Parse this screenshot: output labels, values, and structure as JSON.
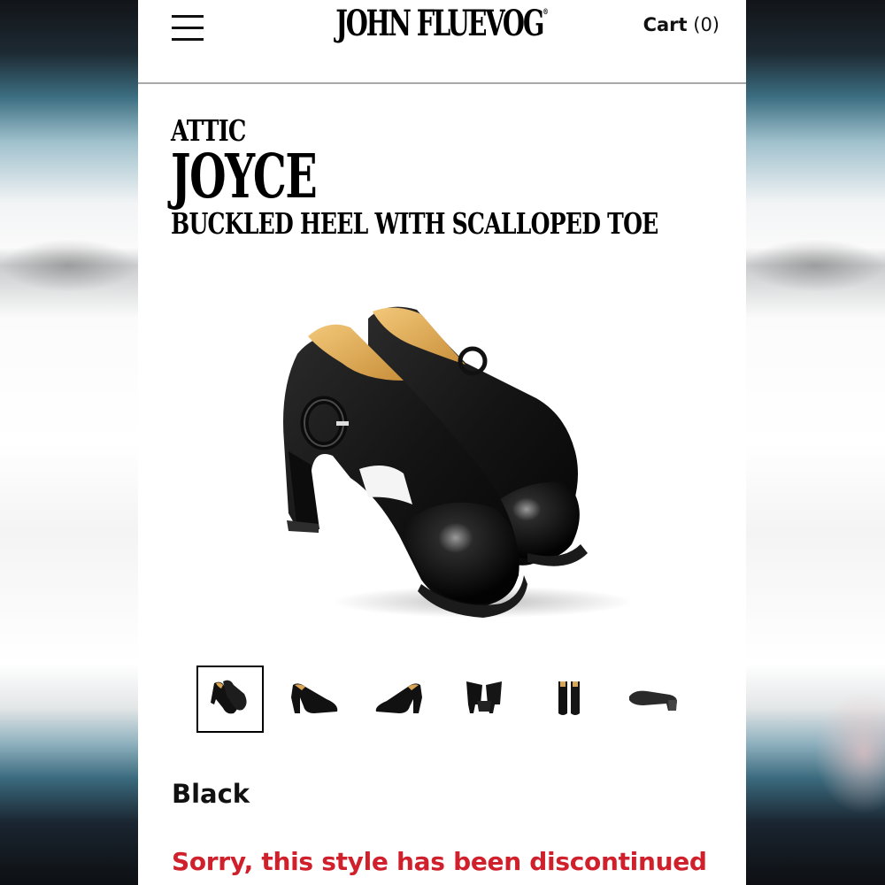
{
  "header": {
    "logo_text": "John Fluevog",
    "logo_mark": "®",
    "cart_label": "Cart",
    "cart_count": "(0)"
  },
  "product": {
    "collection": "ATTIC",
    "name": "JOYCE",
    "description": "BUCKLED HEEL WITH SCALLOPED TOE",
    "color": "Black",
    "status_message": "Sorry, this style has been discontinued",
    "thumbnail_count": 6,
    "active_thumbnail": 1
  },
  "colors": {
    "status": "#d0202b",
    "divider": "#a9a9a9"
  },
  "icons": {
    "menu": "hamburger-menu-icon"
  }
}
